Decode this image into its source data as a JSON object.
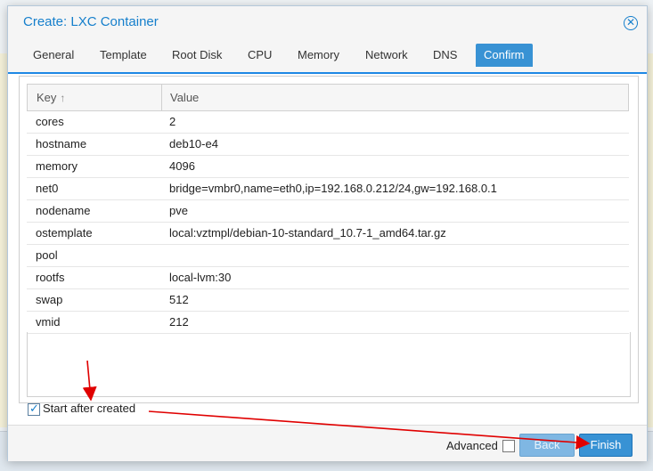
{
  "dialog": {
    "title": "Create: LXC Container"
  },
  "tabs": [
    {
      "label": "General"
    },
    {
      "label": "Template"
    },
    {
      "label": "Root Disk"
    },
    {
      "label": "CPU"
    },
    {
      "label": "Memory"
    },
    {
      "label": "Network"
    },
    {
      "label": "DNS"
    },
    {
      "label": "Confirm",
      "active": true
    }
  ],
  "grid": {
    "headers": {
      "key": "Key",
      "value": "Value"
    },
    "rows": [
      {
        "key": "cores",
        "value": "2"
      },
      {
        "key": "hostname",
        "value": "deb10-e4"
      },
      {
        "key": "memory",
        "value": "4096"
      },
      {
        "key": "net0",
        "value": "bridge=vmbr0,name=eth0,ip=192.168.0.212/24,gw=192.168.0.1"
      },
      {
        "key": "nodename",
        "value": "pve"
      },
      {
        "key": "ostemplate",
        "value": "local:vztmpl/debian-10-standard_10.7-1_amd64.tar.gz"
      },
      {
        "key": "pool",
        "value": ""
      },
      {
        "key": "rootfs",
        "value": "local-lvm:30"
      },
      {
        "key": "swap",
        "value": "512"
      },
      {
        "key": "vmid",
        "value": "212"
      }
    ]
  },
  "start_after_created": {
    "label": "Start after created",
    "checked": true
  },
  "footer": {
    "advanced_label": "Advanced",
    "advanced_checked": false,
    "back_label": "Back",
    "finish_label": "Finish"
  },
  "colors": {
    "accent": "#157fcc",
    "tab_active": "#3892d4",
    "annotation_arrow": "#e00000"
  }
}
